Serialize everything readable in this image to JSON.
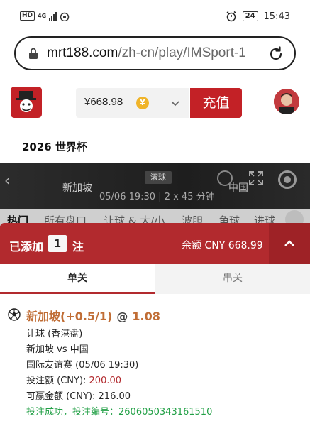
{
  "status_bar": {
    "left_label": "HD",
    "net_label": "4G",
    "time": "15:43",
    "battery": "24",
    "alarm_icon": "alarm-icon",
    "wifi_icon": "wifi-icon"
  },
  "url_bar": {
    "host": "mrt188.com",
    "path": "/zh-cn/play/IMSport-1",
    "lock_icon": "lock-icon",
    "reload_icon": "reload-icon"
  },
  "header": {
    "balance": "¥668.98",
    "coin_symbol": "¥",
    "deposit_label": "充值",
    "brand_color": "#c32126"
  },
  "section_title": "2026 世界杯",
  "match": {
    "live_label": "滚球",
    "home_team": "新加坡",
    "away_team": "中国",
    "time_info": "05/06 19:30 | 2 x 45 分钟"
  },
  "market_tabs": [
    "热门",
    "所有盘口",
    "让球 & 大/小",
    "波胆",
    "角球",
    "进球"
  ],
  "bet_slip": {
    "added_label": "已添加",
    "count": "1",
    "unit": "注",
    "balance_label": "余额 CNY 668.99",
    "tabs": {
      "single": "单关",
      "parlay": "串关"
    },
    "bet": {
      "selection": "新加坡(+0.5/1)",
      "at": "@",
      "odds": "1.08",
      "market": "让球 (香港盘)",
      "match": "新加坡 vs 中国",
      "league": "国际友谊赛 (05/06 19:30)",
      "stake_label": "投注额 (CNY): ",
      "stake_value": "200.00",
      "payout_label": "可赢金额 (CNY): ",
      "payout_value": "216.00",
      "success_text": "投注成功，投注编号：2606050343161510"
    }
  }
}
